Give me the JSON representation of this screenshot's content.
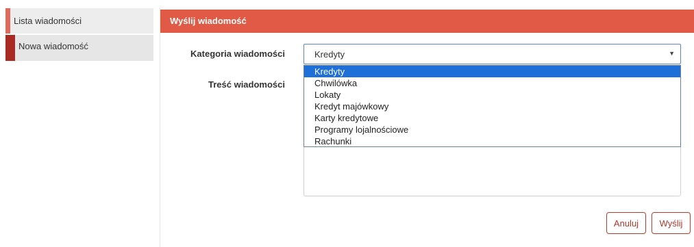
{
  "sidebar": {
    "items": [
      {
        "label": "Lista wiadomości"
      },
      {
        "label": "Nowa wiadomość"
      }
    ]
  },
  "panel": {
    "title": "Wyślij wiadomość"
  },
  "form": {
    "category_label": "Kategoria wiadomości",
    "category_value": "Kredyty",
    "body_label": "Treść wiadomości",
    "options": [
      "Kredyty",
      "Chwilówka",
      "Lokaty",
      "Kredyt majówkowy",
      "Karty kredytowe",
      "Programy lojalnościowe",
      "Rachunki"
    ]
  },
  "buttons": {
    "cancel": "Anuluj",
    "send": "Wyślij"
  },
  "colors": {
    "header": "#e05a45",
    "accent_dark": "#a92a22",
    "accent_light": "#e06a5a",
    "selected_option": "#1e6fd8"
  }
}
